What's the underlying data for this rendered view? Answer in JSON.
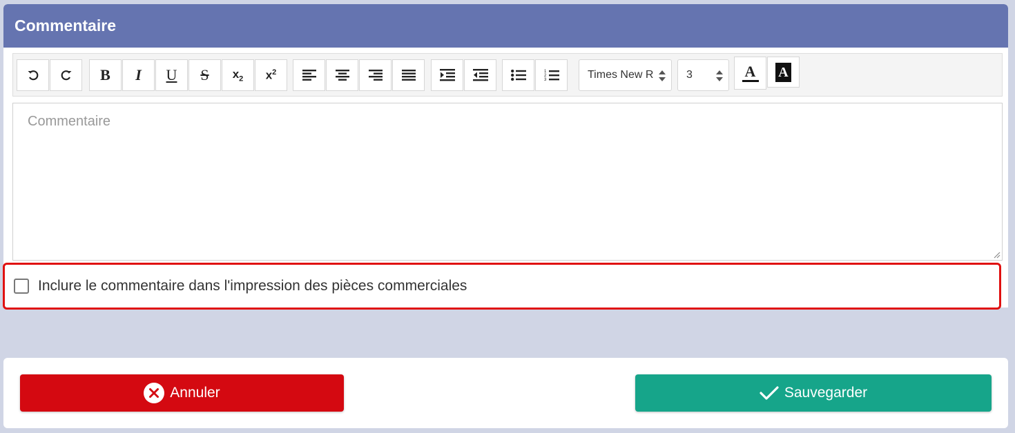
{
  "panel": {
    "title": "Commentaire"
  },
  "toolbar": {
    "font_family": "Times New R",
    "font_size": "3",
    "bold": "B",
    "italic": "I",
    "underline": "U",
    "strike": "S",
    "font_color_label": "A",
    "highlight_label": "A"
  },
  "editor": {
    "placeholder": "Commentaire"
  },
  "include_print": {
    "label": "Inclure le commentaire dans l'impression des pièces commerciales",
    "checked": false
  },
  "footer": {
    "cancel_label": "Annuler",
    "save_label": "Sauvegarder"
  },
  "colors": {
    "header": "#6574b0",
    "cancel": "#d40911",
    "save": "#16a58a",
    "highlight_border": "#e01010"
  }
}
